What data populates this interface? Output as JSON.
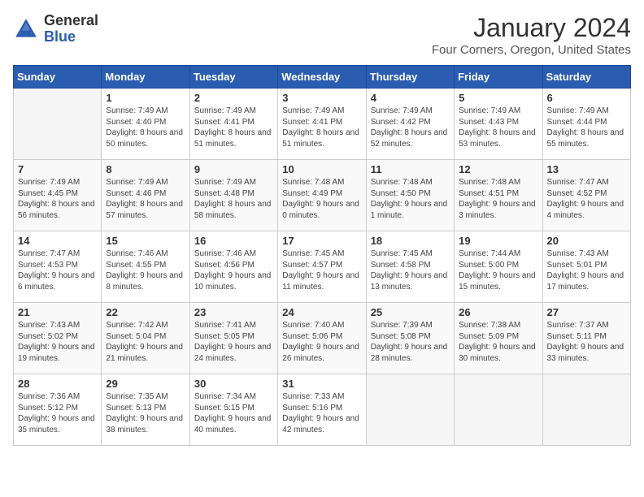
{
  "header": {
    "logo_general": "General",
    "logo_blue": "Blue",
    "month_title": "January 2024",
    "location": "Four Corners, Oregon, United States"
  },
  "days_of_week": [
    "Sunday",
    "Monday",
    "Tuesday",
    "Wednesday",
    "Thursday",
    "Friday",
    "Saturday"
  ],
  "weeks": [
    [
      {
        "day": "",
        "empty": true
      },
      {
        "day": "1",
        "sunrise": "7:49 AM",
        "sunset": "4:40 PM",
        "daylight": "8 hours and 50 minutes."
      },
      {
        "day": "2",
        "sunrise": "7:49 AM",
        "sunset": "4:41 PM",
        "daylight": "8 hours and 51 minutes."
      },
      {
        "day": "3",
        "sunrise": "7:49 AM",
        "sunset": "4:41 PM",
        "daylight": "8 hours and 51 minutes."
      },
      {
        "day": "4",
        "sunrise": "7:49 AM",
        "sunset": "4:42 PM",
        "daylight": "8 hours and 52 minutes."
      },
      {
        "day": "5",
        "sunrise": "7:49 AM",
        "sunset": "4:43 PM",
        "daylight": "8 hours and 53 minutes."
      },
      {
        "day": "6",
        "sunrise": "7:49 AM",
        "sunset": "4:44 PM",
        "daylight": "8 hours and 55 minutes."
      }
    ],
    [
      {
        "day": "7",
        "sunrise": "7:49 AM",
        "sunset": "4:45 PM",
        "daylight": "8 hours and 56 minutes."
      },
      {
        "day": "8",
        "sunrise": "7:49 AM",
        "sunset": "4:46 PM",
        "daylight": "8 hours and 57 minutes."
      },
      {
        "day": "9",
        "sunrise": "7:49 AM",
        "sunset": "4:48 PM",
        "daylight": "8 hours and 58 minutes."
      },
      {
        "day": "10",
        "sunrise": "7:48 AM",
        "sunset": "4:49 PM",
        "daylight": "9 hours and 0 minutes."
      },
      {
        "day": "11",
        "sunrise": "7:48 AM",
        "sunset": "4:50 PM",
        "daylight": "9 hours and 1 minute."
      },
      {
        "day": "12",
        "sunrise": "7:48 AM",
        "sunset": "4:51 PM",
        "daylight": "9 hours and 3 minutes."
      },
      {
        "day": "13",
        "sunrise": "7:47 AM",
        "sunset": "4:52 PM",
        "daylight": "9 hours and 4 minutes."
      }
    ],
    [
      {
        "day": "14",
        "sunrise": "7:47 AM",
        "sunset": "4:53 PM",
        "daylight": "9 hours and 6 minutes."
      },
      {
        "day": "15",
        "sunrise": "7:46 AM",
        "sunset": "4:55 PM",
        "daylight": "9 hours and 8 minutes."
      },
      {
        "day": "16",
        "sunrise": "7:46 AM",
        "sunset": "4:56 PM",
        "daylight": "9 hours and 10 minutes."
      },
      {
        "day": "17",
        "sunrise": "7:45 AM",
        "sunset": "4:57 PM",
        "daylight": "9 hours and 11 minutes."
      },
      {
        "day": "18",
        "sunrise": "7:45 AM",
        "sunset": "4:58 PM",
        "daylight": "9 hours and 13 minutes."
      },
      {
        "day": "19",
        "sunrise": "7:44 AM",
        "sunset": "5:00 PM",
        "daylight": "9 hours and 15 minutes."
      },
      {
        "day": "20",
        "sunrise": "7:43 AM",
        "sunset": "5:01 PM",
        "daylight": "9 hours and 17 minutes."
      }
    ],
    [
      {
        "day": "21",
        "sunrise": "7:43 AM",
        "sunset": "5:02 PM",
        "daylight": "9 hours and 19 minutes."
      },
      {
        "day": "22",
        "sunrise": "7:42 AM",
        "sunset": "5:04 PM",
        "daylight": "9 hours and 21 minutes."
      },
      {
        "day": "23",
        "sunrise": "7:41 AM",
        "sunset": "5:05 PM",
        "daylight": "9 hours and 24 minutes."
      },
      {
        "day": "24",
        "sunrise": "7:40 AM",
        "sunset": "5:06 PM",
        "daylight": "9 hours and 26 minutes."
      },
      {
        "day": "25",
        "sunrise": "7:39 AM",
        "sunset": "5:08 PM",
        "daylight": "9 hours and 28 minutes."
      },
      {
        "day": "26",
        "sunrise": "7:38 AM",
        "sunset": "5:09 PM",
        "daylight": "9 hours and 30 minutes."
      },
      {
        "day": "27",
        "sunrise": "7:37 AM",
        "sunset": "5:11 PM",
        "daylight": "9 hours and 33 minutes."
      }
    ],
    [
      {
        "day": "28",
        "sunrise": "7:36 AM",
        "sunset": "5:12 PM",
        "daylight": "9 hours and 35 minutes."
      },
      {
        "day": "29",
        "sunrise": "7:35 AM",
        "sunset": "5:13 PM",
        "daylight": "9 hours and 38 minutes."
      },
      {
        "day": "30",
        "sunrise": "7:34 AM",
        "sunset": "5:15 PM",
        "daylight": "9 hours and 40 minutes."
      },
      {
        "day": "31",
        "sunrise": "7:33 AM",
        "sunset": "5:16 PM",
        "daylight": "9 hours and 42 minutes."
      },
      {
        "day": "",
        "empty": true
      },
      {
        "day": "",
        "empty": true
      },
      {
        "day": "",
        "empty": true
      }
    ]
  ],
  "labels": {
    "sunrise_prefix": "Sunrise: ",
    "sunset_prefix": "Sunset: ",
    "daylight_prefix": "Daylight: "
  }
}
